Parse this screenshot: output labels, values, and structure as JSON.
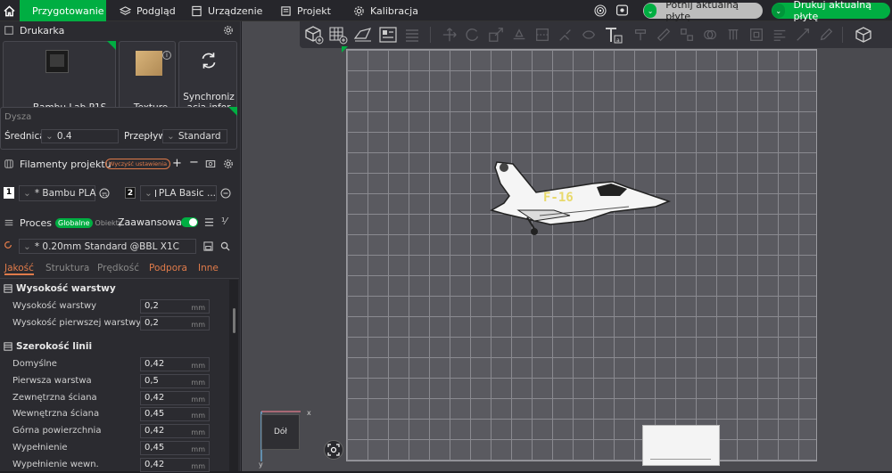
{
  "topbar": {
    "tabs": [
      {
        "label": "Przygotowanie",
        "icon": "cube-icon",
        "active": true
      },
      {
        "label": "Podgląd",
        "icon": "layers-icon"
      },
      {
        "label": "Urządzenie",
        "icon": "printer-icon"
      },
      {
        "label": "Projekt",
        "icon": "document-icon"
      },
      {
        "label": "Kalibracja",
        "icon": "gear-icon"
      }
    ],
    "slice_label": "Potnij aktualną płytę",
    "print_label": "Drukuj aktualną płytę"
  },
  "printer": {
    "title": "Drukarka",
    "printer_name": "Bambu Lab P1S",
    "plate_name": "Texture...",
    "sync_label": "Synchronizacja informa..."
  },
  "nozzle": {
    "title": "Dysza",
    "diameter_label": "Średnica",
    "diameter_value": "0.4",
    "flow_label": "Przepływ",
    "flow_value": "Standard"
  },
  "filaments": {
    "title": "Filamenty projektu",
    "badge": "Wyczyść ustawienia",
    "items": [
      {
        "index": "1",
        "name": "* Bambu PLA ...",
        "color": "#ffffff"
      },
      {
        "index": "2",
        "name": "PLA Basic ...",
        "color": "#111111"
      }
    ]
  },
  "process": {
    "title": "Proces",
    "toggle_global": "Globalne",
    "toggle_objects": "Obiekty",
    "advanced_label": "Zaawansowane",
    "preset": "* 0.20mm Standard @BBL X1C",
    "tabs": [
      "Jakość",
      "Struktura",
      "Prędkość",
      "Podpora",
      "Inne"
    ]
  },
  "settings": {
    "group1_title": "Wysokość warstwy",
    "group1": [
      {
        "name": "Wysokość warstwy",
        "value": "0,2",
        "unit": "mm"
      },
      {
        "name": "Wysokość pierwszej warstwy",
        "value": "0,2",
        "unit": "mm"
      }
    ],
    "group2_title": "Szerokość linii",
    "group2": [
      {
        "name": "Domyślne",
        "value": "0,42",
        "unit": "mm"
      },
      {
        "name": "Pierwsza warstwa",
        "value": "0,5",
        "unit": "mm"
      },
      {
        "name": "Zewnętrzna ściana",
        "value": "0,42",
        "unit": "mm"
      },
      {
        "name": "Wewnętrzna ściana",
        "value": "0,45",
        "unit": "mm"
      },
      {
        "name": "Górna powierzchnia",
        "value": "0,42",
        "unit": "mm"
      },
      {
        "name": "Wypełnienie",
        "value": "0,45",
        "unit": "mm"
      },
      {
        "name": "Wypełnienie wewn.",
        "value": "0,42",
        "unit": "mm"
      }
    ]
  },
  "viewport": {
    "model_text": "F-16",
    "view_cube_label": "Dół",
    "axis_x": "x",
    "axis_y": "y"
  }
}
